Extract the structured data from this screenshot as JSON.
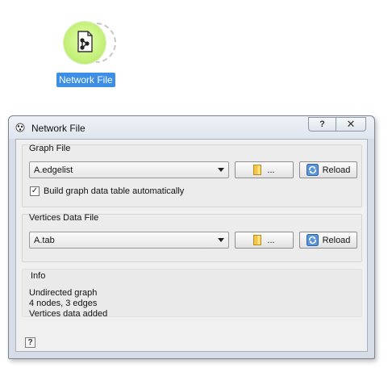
{
  "canvas": {
    "node_label": "Network File",
    "node_icon": "network-file-icon",
    "node_color": "#c7f27d"
  },
  "window": {
    "title": "Network File",
    "title_icon": "network-icon",
    "help_button": "?",
    "close_button": "✕"
  },
  "graph_file": {
    "title": "Graph File",
    "selected": "A.edgelist",
    "browse_label": "...",
    "reload_label": "Reload",
    "build_table_checked": true,
    "build_table_label": "Build graph data table automatically"
  },
  "vertices_file": {
    "title": "Vertices Data File",
    "selected": "A.tab",
    "browse_label": "...",
    "reload_label": "Reload"
  },
  "info": {
    "title": "Info",
    "lines": [
      "Undirected graph",
      "4 nodes, 3 edges",
      "Vertices data added"
    ]
  },
  "footer": {
    "help_label": "?"
  },
  "colors": {
    "selection": "#3c8ee6",
    "window_frame": "#d6dde7"
  }
}
